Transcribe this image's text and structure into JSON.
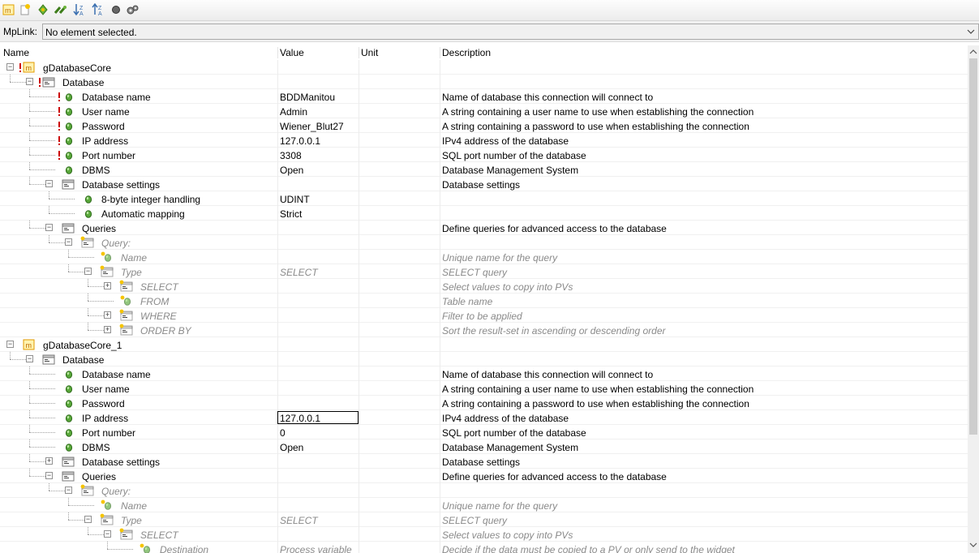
{
  "toolbar": {
    "buttons": [
      {
        "name": "mp-object-button",
        "icon": "mp-object-icon"
      },
      {
        "name": "new-button",
        "icon": "new-icon"
      },
      {
        "name": "navigate-button",
        "icon": "navigate-icon"
      },
      {
        "name": "link-button",
        "icon": "link-icon"
      },
      {
        "name": "sort-desc-button",
        "icon": "sort-desc-icon"
      },
      {
        "name": "sort-asc-button",
        "icon": "sort-asc-icon"
      },
      {
        "name": "record-button",
        "icon": "record-icon"
      },
      {
        "name": "settings-button",
        "icon": "gears-icon"
      }
    ]
  },
  "mplink": {
    "label": "MpLink:",
    "value": "No element selected."
  },
  "columns": {
    "name": "Name",
    "value": "Value",
    "unit": "Unit",
    "description": "Description"
  },
  "rows": [
    {
      "name": "gDatabaseCore",
      "value": "",
      "desc": "",
      "icon": "mp-object-icon",
      "depth": 0,
      "expander": "minus",
      "error": true,
      "italic": false
    },
    {
      "name": "Database",
      "value": "",
      "desc": "",
      "icon": "folder-icon",
      "depth": 1,
      "expander": "minus",
      "error": true,
      "italic": false
    },
    {
      "name": "Database name",
      "value": "BDDManitou",
      "desc": "Name of database this connection will connect to",
      "icon": "parameter-icon",
      "depth": 2,
      "expander": "",
      "error": true,
      "italic": false
    },
    {
      "name": "User name",
      "value": "Admin",
      "desc": "A string containing a user name to use when establishing the connection",
      "icon": "parameter-icon",
      "depth": 2,
      "expander": "",
      "error": true,
      "italic": false
    },
    {
      "name": "Password",
      "value": "Wiener_Blut27",
      "desc": "A string containing a password to use when establishing the connection",
      "icon": "parameter-icon",
      "depth": 2,
      "expander": "",
      "error": true,
      "italic": false
    },
    {
      "name": "IP address",
      "value": "127.0.0.1",
      "desc": "IPv4 address of the database",
      "icon": "parameter-icon",
      "depth": 2,
      "expander": "",
      "error": true,
      "italic": false
    },
    {
      "name": "Port number",
      "value": "3308",
      "desc": "SQL port number of the database",
      "icon": "parameter-icon",
      "depth": 2,
      "expander": "",
      "error": true,
      "italic": false
    },
    {
      "name": "DBMS",
      "value": "Open",
      "desc": "Database Management System",
      "icon": "parameter-icon",
      "depth": 2,
      "expander": "",
      "error": false,
      "italic": false
    },
    {
      "name": "Database settings",
      "value": "",
      "desc": "Database settings",
      "icon": "folder-icon",
      "depth": 2,
      "expander": "minus",
      "error": false,
      "italic": false
    },
    {
      "name": "8-byte integer handling",
      "value": "UDINT",
      "desc": "",
      "icon": "parameter-icon",
      "depth": 3,
      "expander": "",
      "error": false,
      "italic": false
    },
    {
      "name": "Automatic mapping",
      "value": "Strict",
      "desc": "",
      "icon": "parameter-icon",
      "depth": 3,
      "expander": "",
      "error": false,
      "italic": false
    },
    {
      "name": "Queries",
      "value": "",
      "desc": "Define queries for advanced access to the database",
      "icon": "folder-icon",
      "depth": 2,
      "expander": "minus",
      "error": false,
      "italic": false
    },
    {
      "name": "Query:",
      "value": "",
      "desc": "",
      "icon": "folder-new-icon",
      "depth": 3,
      "expander": "minus",
      "error": false,
      "italic": true
    },
    {
      "name": "Name",
      "value": "",
      "desc": "Unique name for the query",
      "icon": "parameter-new-icon",
      "depth": 4,
      "expander": "",
      "error": false,
      "italic": true
    },
    {
      "name": "Type",
      "value": "SELECT",
      "desc": "SELECT query",
      "icon": "folder-new-icon",
      "depth": 4,
      "expander": "minus",
      "error": false,
      "italic": true
    },
    {
      "name": "SELECT",
      "value": "",
      "desc": "Select values to copy into PVs",
      "icon": "folder-new-icon",
      "depth": 5,
      "expander": "plus",
      "error": false,
      "italic": true
    },
    {
      "name": "FROM",
      "value": "",
      "desc": "Table name",
      "icon": "parameter-new-icon",
      "depth": 5,
      "expander": "",
      "error": false,
      "italic": true
    },
    {
      "name": "WHERE",
      "value": "",
      "desc": "Filter to be applied",
      "icon": "folder-new-icon",
      "depth": 5,
      "expander": "plus",
      "error": false,
      "italic": true
    },
    {
      "name": "ORDER BY",
      "value": "",
      "desc": "Sort the result-set in ascending or descending order",
      "icon": "folder-new-icon",
      "depth": 5,
      "expander": "plus",
      "error": false,
      "italic": true
    },
    {
      "name": "gDatabaseCore_1",
      "value": "",
      "desc": "",
      "icon": "mp-object-icon",
      "depth": 0,
      "expander": "minus",
      "error": false,
      "italic": false
    },
    {
      "name": "Database",
      "value": "",
      "desc": "",
      "icon": "folder-icon",
      "depth": 1,
      "expander": "minus",
      "error": false,
      "italic": false
    },
    {
      "name": "Database name",
      "value": "",
      "desc": "Name of database this connection will connect to",
      "icon": "parameter-icon",
      "depth": 2,
      "expander": "",
      "error": false,
      "italic": false
    },
    {
      "name": "User name",
      "value": "",
      "desc": "A string containing a user name to use when establishing the connection",
      "icon": "parameter-icon",
      "depth": 2,
      "expander": "",
      "error": false,
      "italic": false
    },
    {
      "name": "Password",
      "value": "",
      "desc": "A string containing a password to use when establishing the connection",
      "icon": "parameter-icon",
      "depth": 2,
      "expander": "",
      "error": false,
      "italic": false
    },
    {
      "name": "IP address",
      "value": "127.0.0.1",
      "desc": "IPv4 address of the database",
      "icon": "parameter-icon",
      "depth": 2,
      "expander": "",
      "error": false,
      "italic": false,
      "editing": true
    },
    {
      "name": "Port number",
      "value": "0",
      "desc": "SQL port number of the database",
      "icon": "parameter-icon",
      "depth": 2,
      "expander": "",
      "error": false,
      "italic": false
    },
    {
      "name": "DBMS",
      "value": "Open",
      "desc": "Database Management System",
      "icon": "parameter-icon",
      "depth": 2,
      "expander": "",
      "error": false,
      "italic": false
    },
    {
      "name": "Database settings",
      "value": "",
      "desc": "Database settings",
      "icon": "folder-icon",
      "depth": 2,
      "expander": "plus",
      "error": false,
      "italic": false
    },
    {
      "name": "Queries",
      "value": "",
      "desc": "Define queries for advanced access to the database",
      "icon": "folder-icon",
      "depth": 2,
      "expander": "minus",
      "error": false,
      "italic": false
    },
    {
      "name": "Query:",
      "value": "",
      "desc": "",
      "icon": "folder-new-icon",
      "depth": 3,
      "expander": "minus",
      "error": false,
      "italic": true
    },
    {
      "name": "Name",
      "value": "",
      "desc": "Unique name for the query",
      "icon": "parameter-new-icon",
      "depth": 4,
      "expander": "",
      "error": false,
      "italic": true
    },
    {
      "name": "Type",
      "value": "SELECT",
      "desc": "SELECT query",
      "icon": "folder-new-icon",
      "depth": 4,
      "expander": "minus",
      "error": false,
      "italic": true
    },
    {
      "name": "SELECT",
      "value": "",
      "desc": "Select values to copy into PVs",
      "icon": "folder-new-icon",
      "depth": 5,
      "expander": "minus",
      "error": false,
      "italic": true
    },
    {
      "name": "Destination",
      "value": "Process variable",
      "desc": "Decide if the data must be copied to a PV or only send to the widget",
      "icon": "parameter-new-icon",
      "depth": 6,
      "expander": "",
      "error": false,
      "italic": true
    }
  ]
}
